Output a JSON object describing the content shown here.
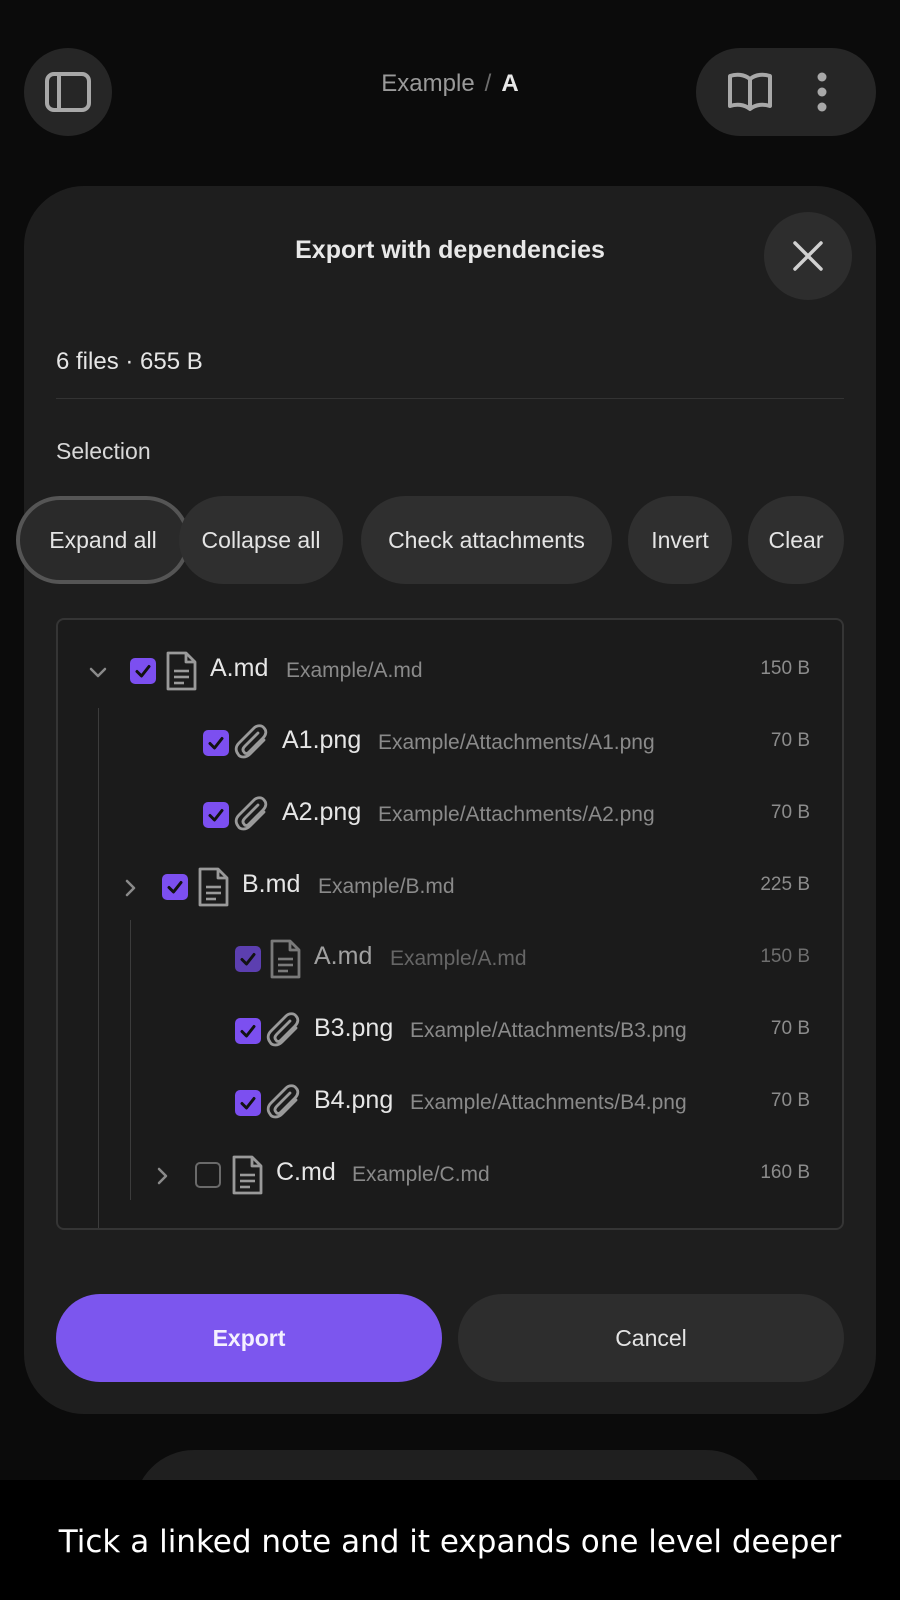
{
  "header": {
    "breadcrumb_parent": "Example",
    "breadcrumb_separator": "/",
    "breadcrumb_current": "A",
    "icons": [
      "sidebar-toggle-icon",
      "book-open-icon",
      "more-vertical-icon"
    ]
  },
  "modal": {
    "title": "Export with dependencies",
    "summary": "6 files · 655 B",
    "selection_label": "Selection",
    "chips": [
      {
        "label": "Expand all",
        "active": true
      },
      {
        "label": "Collapse all"
      },
      {
        "label": "Check attachments"
      },
      {
        "label": "Invert"
      },
      {
        "label": "Clear"
      }
    ],
    "tree": [
      {
        "name": "A.md",
        "path": "Example/A.md",
        "size": "150 B",
        "type": "note",
        "checked": true,
        "depth": 0,
        "expander": "expanded"
      },
      {
        "name": "A1.png",
        "path": "Example/Attachments/A1.png",
        "size": "70 B",
        "type": "attachment",
        "checked": true,
        "depth": 1
      },
      {
        "name": "A2.png",
        "path": "Example/Attachments/A2.png",
        "size": "70 B",
        "type": "attachment",
        "checked": true,
        "depth": 1
      },
      {
        "name": "B.md",
        "path": "Example/B.md",
        "size": "225 B",
        "type": "note",
        "checked": true,
        "depth": 1,
        "expander": "collapsed"
      },
      {
        "name": "A.md",
        "path": "Example/A.md",
        "size": "150 B",
        "type": "note",
        "checked": true,
        "depth": 2,
        "dimmed": true
      },
      {
        "name": "B3.png",
        "path": "Example/Attachments/B3.png",
        "size": "70 B",
        "type": "attachment",
        "checked": true,
        "depth": 2
      },
      {
        "name": "B4.png",
        "path": "Example/Attachments/B4.png",
        "size": "70 B",
        "type": "attachment",
        "checked": true,
        "depth": 2
      },
      {
        "name": "C.md",
        "path": "Example/C.md",
        "size": "160 B",
        "type": "note",
        "checked": false,
        "depth": 1,
        "expander": "collapsed"
      }
    ],
    "export_label": "Export",
    "cancel_label": "Cancel"
  },
  "colors": {
    "accent": "#7c56ee",
    "checkbox": "#7c4ff0",
    "background": "#0b0b0b",
    "surface": "#1e1e1e"
  },
  "caption": "Tick a linked note and it expands one level deeper"
}
